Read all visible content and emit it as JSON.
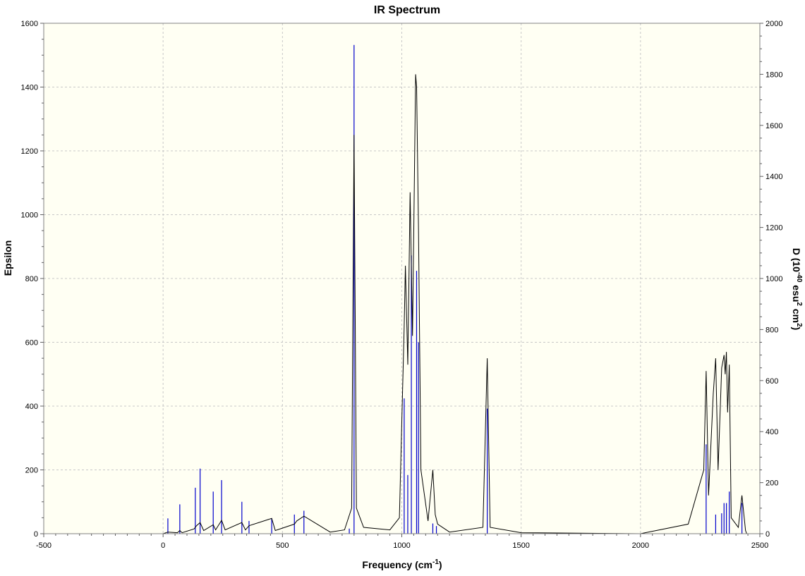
{
  "chart_data": {
    "type": "line",
    "title": "IR Spectrum",
    "xlabel_main": "Frequency (cm",
    "xlabel_sup": "-1",
    "xlabel_end": ")",
    "ylabel_left": "Epsilon",
    "ylabel_right_parts": [
      "D (10",
      "-40",
      " esu",
      "2",
      " cm",
      "2",
      ")"
    ],
    "xlim": [
      -500,
      2500
    ],
    "ylim_left": [
      0,
      1600
    ],
    "ylim_right": [
      0,
      2000
    ],
    "x_ticks": [
      -500,
      0,
      500,
      1000,
      1500,
      2000,
      2500
    ],
    "y_ticks_left": [
      0,
      200,
      400,
      600,
      800,
      1000,
      1200,
      1400,
      1600
    ],
    "y_ticks_right": [
      0,
      200,
      400,
      600,
      800,
      1000,
      1200,
      1400,
      1600,
      1800,
      2000
    ],
    "grid": true,
    "colors": {
      "background": "#fffff3",
      "spectrum_line": "#000000",
      "stick_lines": "#0000cc",
      "grid": "#c8c8c8"
    },
    "series": [
      {
        "kind": "stick",
        "axis": "right",
        "x": [
          20,
          70,
          135,
          155,
          210,
          245,
          330,
          360,
          455,
          550,
          590,
          780,
          800,
          1010,
          1025,
          1040,
          1062,
          1070,
          1130,
          1145,
          1358,
          2275,
          2315,
          2340,
          2350,
          2360,
          2372,
          2425
        ],
        "values": [
          60,
          115,
          180,
          255,
          165,
          210,
          125,
          50,
          60,
          75,
          90,
          20,
          1915,
          530,
          230,
          1090,
          1030,
          750,
          40,
          30,
          490,
          350,
          75,
          80,
          120,
          120,
          165,
          120
        ]
      },
      {
        "kind": "broadened",
        "axis": "left",
        "x": [
          0,
          20,
          60,
          70,
          80,
          130,
          140,
          155,
          170,
          210,
          220,
          245,
          260,
          330,
          345,
          360,
          455,
          470,
          550,
          560,
          590,
          700,
          760,
          790,
          800,
          810,
          840,
          950,
          990,
          1010,
          1015,
          1025,
          1035,
          1045,
          1058,
          1062,
          1070,
          1080,
          1110,
          1130,
          1140,
          1150,
          1200,
          1340,
          1358,
          1370,
          1500,
          2000,
          2200,
          2265,
          2275,
          2285,
          2305,
          2315,
          2325,
          2340,
          2350,
          2355,
          2360,
          2365,
          2372,
          2380,
          2410,
          2425,
          2440,
          2445
        ],
        "values": [
          0,
          5,
          3,
          10,
          3,
          15,
          25,
          35,
          10,
          28,
          12,
          42,
          12,
          35,
          12,
          25,
          48,
          10,
          30,
          40,
          55,
          5,
          12,
          80,
          1250,
          80,
          20,
          12,
          50,
          650,
          840,
          530,
          1070,
          620,
          1440,
          1400,
          950,
          200,
          40,
          200,
          60,
          30,
          5,
          20,
          550,
          20,
          3,
          0,
          30,
          200,
          510,
          120,
          440,
          550,
          200,
          520,
          560,
          500,
          570,
          380,
          530,
          50,
          20,
          120,
          10,
          0
        ]
      }
    ]
  }
}
